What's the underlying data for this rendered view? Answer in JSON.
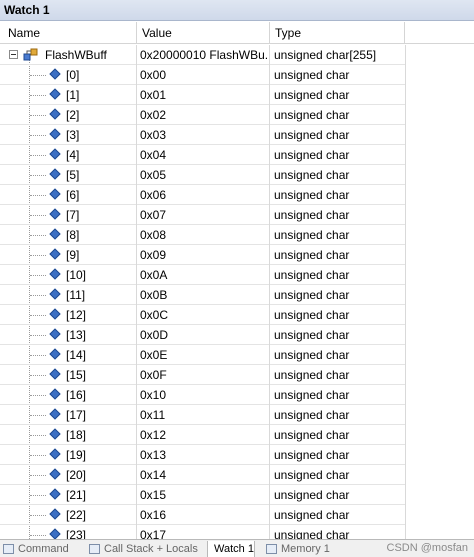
{
  "window": {
    "title": "Watch 1"
  },
  "columns": {
    "name": "Name",
    "value": "Value",
    "type": "Type"
  },
  "root": {
    "name": "FlashWBuff",
    "value": "0x20000010 FlashWBu...",
    "type": "unsigned char[255]"
  },
  "elements": [
    {
      "index": "[0]",
      "value": "0x00",
      "type": "unsigned char"
    },
    {
      "index": "[1]",
      "value": "0x01",
      "type": "unsigned char"
    },
    {
      "index": "[2]",
      "value": "0x02",
      "type": "unsigned char"
    },
    {
      "index": "[3]",
      "value": "0x03",
      "type": "unsigned char"
    },
    {
      "index": "[4]",
      "value": "0x04",
      "type": "unsigned char"
    },
    {
      "index": "[5]",
      "value": "0x05",
      "type": "unsigned char"
    },
    {
      "index": "[6]",
      "value": "0x06",
      "type": "unsigned char"
    },
    {
      "index": "[7]",
      "value": "0x07",
      "type": "unsigned char"
    },
    {
      "index": "[8]",
      "value": "0x08",
      "type": "unsigned char"
    },
    {
      "index": "[9]",
      "value": "0x09",
      "type": "unsigned char"
    },
    {
      "index": "[10]",
      "value": "0x0A",
      "type": "unsigned char"
    },
    {
      "index": "[11]",
      "value": "0x0B",
      "type": "unsigned char"
    },
    {
      "index": "[12]",
      "value": "0x0C",
      "type": "unsigned char"
    },
    {
      "index": "[13]",
      "value": "0x0D",
      "type": "unsigned char"
    },
    {
      "index": "[14]",
      "value": "0x0E",
      "type": "unsigned char"
    },
    {
      "index": "[15]",
      "value": "0x0F",
      "type": "unsigned char"
    },
    {
      "index": "[16]",
      "value": "0x10",
      "type": "unsigned char"
    },
    {
      "index": "[17]",
      "value": "0x11",
      "type": "unsigned char"
    },
    {
      "index": "[18]",
      "value": "0x12",
      "type": "unsigned char"
    },
    {
      "index": "[19]",
      "value": "0x13",
      "type": "unsigned char"
    },
    {
      "index": "[20]",
      "value": "0x14",
      "type": "unsigned char"
    },
    {
      "index": "[21]",
      "value": "0x15",
      "type": "unsigned char"
    },
    {
      "index": "[22]",
      "value": "0x16",
      "type": "unsigned char"
    },
    {
      "index": "[23]",
      "value": "0x17",
      "type": "unsigned char"
    }
  ],
  "tabs": [
    {
      "label": "Command",
      "icon": "command-window-icon",
      "active": false
    },
    {
      "label": "Call Stack + Locals",
      "icon": "call-stack-icon",
      "active": false
    },
    {
      "label": "Watch 1",
      "icon": "",
      "active": true
    },
    {
      "label": "Memory 1",
      "icon": "memory-icon",
      "active": false
    }
  ],
  "watermark": "CSDN @mosfan"
}
